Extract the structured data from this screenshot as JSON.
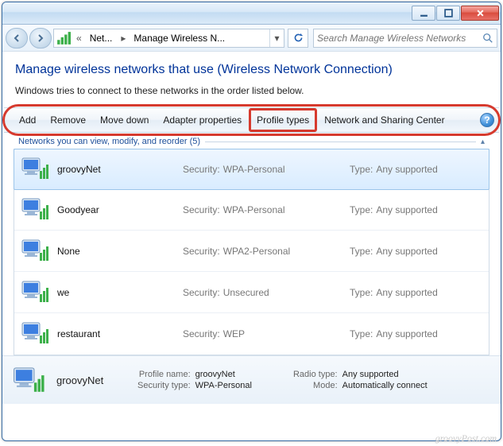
{
  "window": {
    "minimize": "Minimize",
    "maximize": "Maximize",
    "close": "Close"
  },
  "breadcrumb": {
    "seg1": "Net...",
    "seg2": "Manage Wireless N..."
  },
  "search": {
    "placeholder": "Search Manage Wireless Networks"
  },
  "heading": "Manage wireless networks that use (Wireless Network Connection)",
  "subtext": "Windows tries to connect to these networks in the order listed below.",
  "toolbar": {
    "add": "Add",
    "remove": "Remove",
    "movedown": "Move down",
    "adapter": "Adapter properties",
    "profiletypes": "Profile types",
    "nsc": "Network and Sharing Center",
    "help": "?"
  },
  "group": {
    "label": "Networks you can view, modify, and reorder (5)"
  },
  "labels": {
    "security": "Security:",
    "type": "Type:",
    "profilename": "Profile name:",
    "securitytype": "Security type:",
    "radiotype": "Radio type:",
    "mode": "Mode:"
  },
  "rows": [
    {
      "name": "groovyNet",
      "security": "WPA-Personal",
      "type": "Any supported"
    },
    {
      "name": "Goodyear",
      "security": "WPA-Personal",
      "type": "Any supported"
    },
    {
      "name": "None",
      "security": "WPA2-Personal",
      "type": "Any supported"
    },
    {
      "name": "we",
      "security": "Unsecured",
      "type": "Any supported"
    },
    {
      "name": "restaurant",
      "security": "WEP",
      "type": "Any supported"
    }
  ],
  "details": {
    "name": "groovyNet",
    "profilename": "groovyNet",
    "securitytype": "WPA-Personal",
    "radiotype": "Any supported",
    "mode": "Automatically connect"
  },
  "watermark": "groovyPost.com"
}
